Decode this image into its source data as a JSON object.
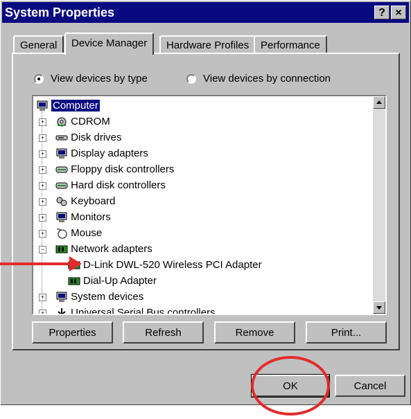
{
  "window": {
    "title": "System Properties",
    "help_label": "?",
    "close_label": "×"
  },
  "tabs": [
    {
      "label": "General"
    },
    {
      "label": "Device Manager"
    },
    {
      "label": "Hardware Profiles"
    },
    {
      "label": "Performance"
    }
  ],
  "view_options": {
    "by_type": "View devices by type",
    "by_connection": "View devices by connection",
    "selected": "by_type"
  },
  "tree": {
    "root": "Computer",
    "items": [
      {
        "label": "CDROM",
        "icon": "cdrom-icon"
      },
      {
        "label": "Disk drives",
        "icon": "disk-drive-icon"
      },
      {
        "label": "Display adapters",
        "icon": "monitor-icon"
      },
      {
        "label": "Floppy disk controllers",
        "icon": "controller-icon"
      },
      {
        "label": "Hard disk controllers",
        "icon": "controller-icon"
      },
      {
        "label": "Keyboard",
        "icon": "keyboard-icon"
      },
      {
        "label": "Monitors",
        "icon": "monitor-icon"
      },
      {
        "label": "Mouse",
        "icon": "mouse-icon"
      },
      {
        "label": "Network adapters",
        "icon": "network-card-icon"
      },
      {
        "label": "D-Link DWL-520 Wireless PCI Adapter",
        "icon": "network-card-icon"
      },
      {
        "label": "Dial-Up Adapter",
        "icon": "network-card-icon"
      },
      {
        "label": "System devices",
        "icon": "monitor-icon"
      },
      {
        "label": "Universal Serial Bus controllers",
        "icon": "usb-icon"
      }
    ]
  },
  "buttons": {
    "properties": "Properties",
    "refresh": "Refresh",
    "remove": "Remove",
    "print": "Print...",
    "ok": "OK",
    "cancel": "Cancel"
  },
  "colors": {
    "annotation": "#e32b2b",
    "titlebar": "#0a0a80",
    "face": "#c0c0c0"
  }
}
